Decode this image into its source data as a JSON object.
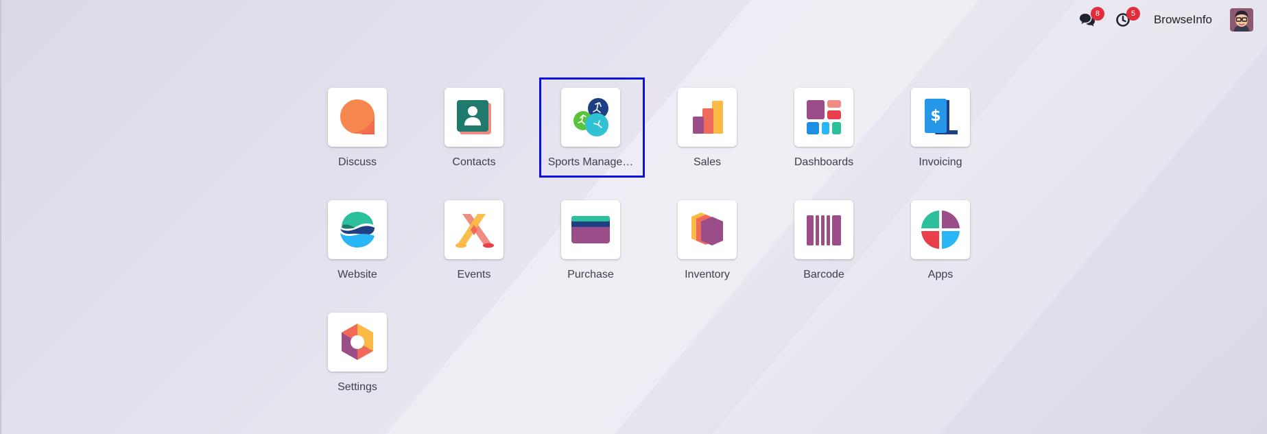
{
  "topbar": {
    "messages_badge": "8",
    "activities_badge": "5",
    "company_name": "BrowseInfo",
    "messages_icon": "chat-bubbles-icon",
    "activities_icon": "clock-icon"
  },
  "apps": [
    {
      "label": "Discuss",
      "icon": "discuss-icon"
    },
    {
      "label": "Contacts",
      "icon": "contacts-icon"
    },
    {
      "label": "Sports Manage…",
      "icon": "sports-management-icon",
      "selected": true
    },
    {
      "label": "Sales",
      "icon": "sales-icon"
    },
    {
      "label": "Dashboards",
      "icon": "dashboards-icon"
    },
    {
      "label": "Invoicing",
      "icon": "invoicing-icon"
    },
    {
      "label": "Website",
      "icon": "website-icon"
    },
    {
      "label": "Events",
      "icon": "events-icon"
    },
    {
      "label": "Purchase",
      "icon": "purchase-icon"
    },
    {
      "label": "Inventory",
      "icon": "inventory-icon"
    },
    {
      "label": "Barcode",
      "icon": "barcode-icon"
    },
    {
      "label": "Apps",
      "icon": "apps-icon"
    },
    {
      "label": "Settings",
      "icon": "settings-icon"
    }
  ],
  "colors": {
    "selection_border": "#0a10e0",
    "badge": "#e02d3c"
  }
}
